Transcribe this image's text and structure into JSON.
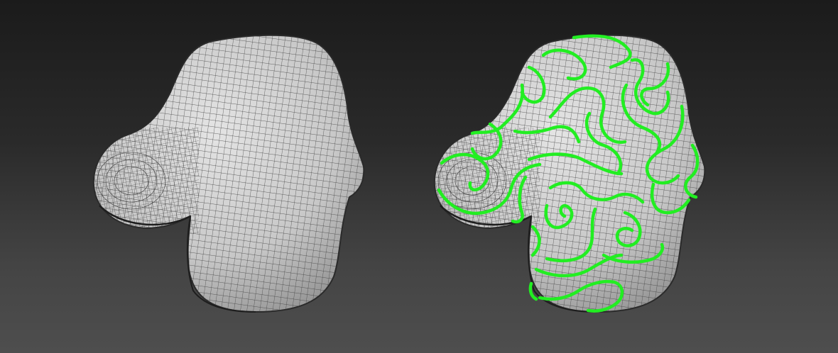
{
  "viewport": {
    "background_top": "#1b1b1b",
    "background_bottom": "#4e4e4e"
  },
  "models": [
    {
      "name": "nose-mesh-wireframe",
      "surface_color": "#cfcfcf",
      "wire_color": "#3a3a3a",
      "has_curves": false
    },
    {
      "name": "nose-mesh-with-curves",
      "surface_color": "#cfcfcf",
      "wire_color": "#3a3a3a",
      "has_curves": true,
      "curve_color": "#22ee22"
    }
  ]
}
